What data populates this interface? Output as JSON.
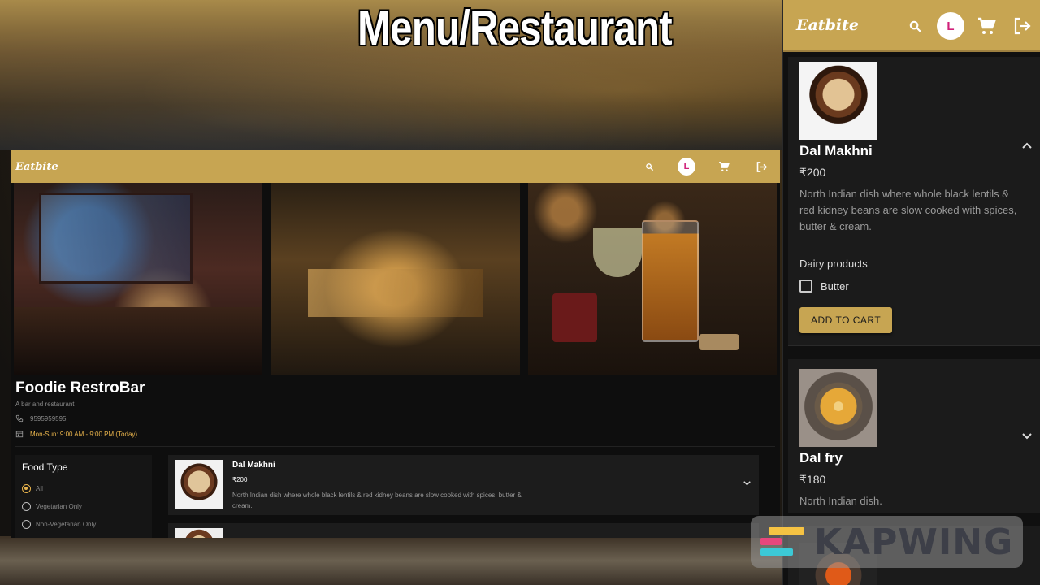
{
  "overlay_title": "Menu/Restaurant",
  "watermark": {
    "text": "KAPWING"
  },
  "brand": "Eatbite",
  "avatar_initial": "L",
  "icons": {
    "search": "search-icon",
    "cart": "cart-icon",
    "logout": "logout-icon"
  },
  "colors": {
    "accent": "#c7a552",
    "hours": "#e9b44c",
    "avatar_text": "#d0217a"
  },
  "restaurant": {
    "name": "Foodie RestroBar",
    "subtitle": "A bar and restaurant",
    "phone": "9595959595",
    "hours": "Mon-Sun: 9:00 AM - 9:00 PM (Today)"
  },
  "filter": {
    "title": "Food Type",
    "options": [
      "All",
      "Vegetarian Only",
      "Non-Vegetarian Only"
    ],
    "selected": "All"
  },
  "menu_items": [
    {
      "name": "Dal Makhni",
      "price": "₹200",
      "description": "North Indian dish where whole black lentils & red kidney beans are slow cooked with spices, butter & cream."
    },
    {
      "name": "Dal fry",
      "price": "₹180",
      "description": "North Indian dish."
    }
  ],
  "detail_card": {
    "addon_section": "Dairy products",
    "addon_option": "Butter",
    "addon_checked": false,
    "add_to_cart": "ADD TO CART"
  }
}
